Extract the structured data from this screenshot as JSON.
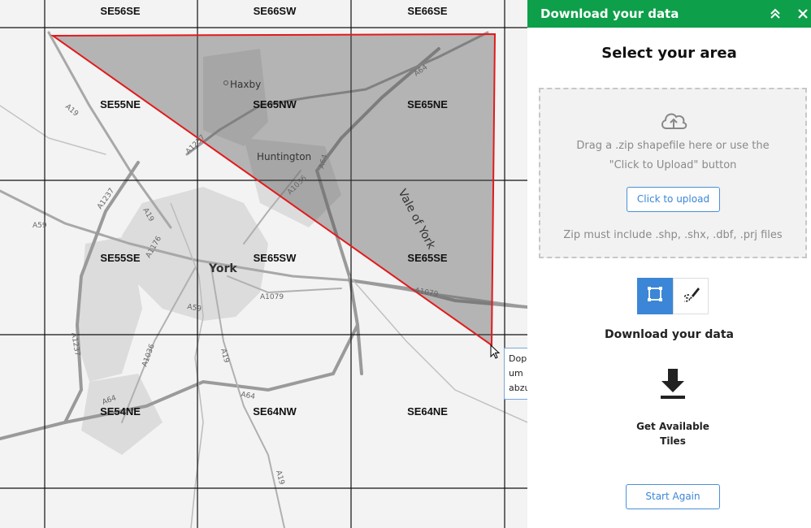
{
  "map": {
    "tiles": [
      "SE56SE",
      "SE66SW",
      "SE66SE",
      "SE55NE",
      "SE65NW",
      "SE65NE",
      "SE55SE",
      "SE65SW",
      "SE65SE",
      "SE54NE",
      "SE64NW",
      "SE64NE"
    ],
    "places": {
      "york": "York",
      "haxby": "Haxby",
      "huntington": "Huntington",
      "vale": "Vale of York"
    },
    "roads": {
      "a64_n": "A64",
      "a19_nw": "A19",
      "a1237_n": "A1237",
      "a1237_w": "A1237",
      "a59": "A59",
      "a19_w": "A19",
      "a1176": "A1176",
      "a1036": "A1036",
      "a1036_s": "A1036",
      "a1079": "A1079",
      "a1079_e": "A1079",
      "a64_ne": "A64",
      "a19_s": "A19",
      "a64_s": "A64",
      "a64_sw": "A64",
      "a19_se": "A19",
      "a59_c": "A59"
    },
    "tooltip_lines": [
      "Doppelklicken,",
      "um",
      "abzuschließen"
    ],
    "polygon_color": "#e31a1c"
  },
  "panel": {
    "header_title": "Download your data",
    "header_color": "#0e9f4a",
    "collapse_icon": "double-chevron-up-icon",
    "close_icon": "close-icon",
    "select_title": "Select your area",
    "drop_text": "Drag a .zip shapefile here or use the \"Click to Upload\" button",
    "upload_label": "Click to upload",
    "zip_note": "Zip must include .shp, .shx, .dbf, .prj files",
    "tools": [
      {
        "icon": "bounding-box-icon",
        "active": true
      },
      {
        "icon": "freehand-draw-icon",
        "active": false
      }
    ],
    "download_title": "Download your data",
    "tiles_label": "Get Available Tiles",
    "start_again_label": "Start Again"
  }
}
